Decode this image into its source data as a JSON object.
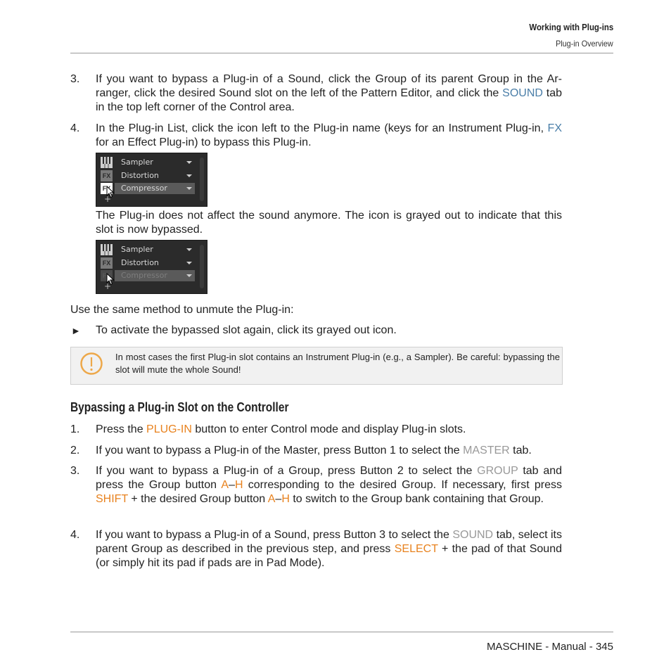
{
  "header": {
    "chapter": "Working with Plug-ins",
    "section": "Plug-in Overview"
  },
  "steps_a": [
    {
      "number": "3.",
      "parts": [
        {
          "text": "If you want to bypass a Plug-in of a Sound, click the Group of its parent Group in the Ar­ranger, click the desired Sound slot on the left of the Pattern Editor, and click the ",
          "style": ""
        },
        {
          "text": "SOUND",
          "style": "blue"
        },
        {
          "text": " tab in the top left corner of the Control area.",
          "style": ""
        }
      ]
    },
    {
      "number": "4.",
      "parts": [
        {
          "text": "In the Plug-in List, click the icon left to the Plug-in name (keys for an Instrument Plug-in, ",
          "style": ""
        },
        {
          "text": "FX",
          "style": "blue"
        },
        {
          "text": " for an Effect Plug-in) to bypass this Plug-in.",
          "style": ""
        }
      ]
    }
  ],
  "plugin_list_active": {
    "slots": [
      {
        "icon": "keys-icon",
        "icon_label": "",
        "name": "Sampler",
        "state": "normal"
      },
      {
        "icon": "fx-icon",
        "icon_label": "FX",
        "name": "Distortion",
        "state": "normal"
      },
      {
        "icon": "fx-icon",
        "icon_label": "FX",
        "name": "Compressor",
        "state": "selected-hover"
      }
    ],
    "add_label": "+"
  },
  "after_bypass_text": "The Plug-in does not affect the sound anymore. The icon is grayed out to indicate that this slot is now bypassed.",
  "plugin_list_bypassed": {
    "slots": [
      {
        "icon": "keys-icon",
        "icon_label": "",
        "name": "Sampler",
        "state": "normal"
      },
      {
        "icon": "fx-icon",
        "icon_label": "FX",
        "name": "Distortion",
        "state": "normal"
      },
      {
        "icon": "fx-icon",
        "icon_label": "FX",
        "name": "Compressor",
        "state": "bypassed"
      }
    ],
    "add_label": "+"
  },
  "unmute_intro": "Use the same method to unmute the Plug-in:",
  "unmute_bullet": {
    "marker": "►",
    "text": "To activate the bypassed slot again, click its grayed out icon."
  },
  "note": {
    "icon": "warning-icon",
    "text": "In most cases the first Plug-in slot contains an Instrument Plug-in (e.g., a Sampler). Be careful: by­passing the slot will mute the whole Sound!"
  },
  "section_heading": "Bypassing a Plug-in Slot on the Controller",
  "steps_b": [
    {
      "number": "1.",
      "parts": [
        {
          "text": "Press the ",
          "style": ""
        },
        {
          "text": "PLUG-IN",
          "style": "orange"
        },
        {
          "text": " button to enter Control mode and display Plug-in slots.",
          "style": ""
        }
      ]
    },
    {
      "number": "2.",
      "parts": [
        {
          "text": "If you want to bypass a Plug-in of the Master, press Button 1 to select the ",
          "style": ""
        },
        {
          "text": "MASTER",
          "style": "gray"
        },
        {
          "text": " tab.",
          "style": ""
        }
      ]
    },
    {
      "number": "3.",
      "parts": [
        {
          "text": "If you want to bypass a Plug-in of a Group, press Button 2 to select the ",
          "style": ""
        },
        {
          "text": "GROUP",
          "style": "gray"
        },
        {
          "text": " tab and press the Group button ",
          "style": ""
        },
        {
          "text": "A",
          "style": "orange"
        },
        {
          "text": "–",
          "style": ""
        },
        {
          "text": "H",
          "style": "orange"
        },
        {
          "text": " corresponding to the desired Group. If necessary, first press ",
          "style": ""
        },
        {
          "text": "SHIFT",
          "style": "orange"
        },
        {
          "text": " + the desired Group button ",
          "style": ""
        },
        {
          "text": "A",
          "style": "orange"
        },
        {
          "text": "–",
          "style": ""
        },
        {
          "text": "H",
          "style": "orange"
        },
        {
          "text": " to switch to the Group bank containing that Group.",
          "style": ""
        }
      ]
    },
    {
      "number": "4.",
      "parts": [
        {
          "text": "If you want to bypass a Plug-in of a Sound, press Button 3 to select the ",
          "style": ""
        },
        {
          "text": "SOUND",
          "style": "gray"
        },
        {
          "text": " tab, se­lect its parent Group as described in the previous step, and press ",
          "style": ""
        },
        {
          "text": "SELECT",
          "style": "orange"
        },
        {
          "text": " + the pad of that Sound (or simply hit its pad if pads are in Pad Mode).",
          "style": ""
        }
      ]
    }
  ],
  "footer": {
    "text": "MASCHINE - Manual - 345"
  },
  "colors": {
    "ui_link_blue": "#4a7ea8",
    "controller_orange": "#e8821e",
    "tab_gray": "#999999",
    "note_icon_orange": "#eda84a",
    "note_bg": "#f1f1f1"
  }
}
